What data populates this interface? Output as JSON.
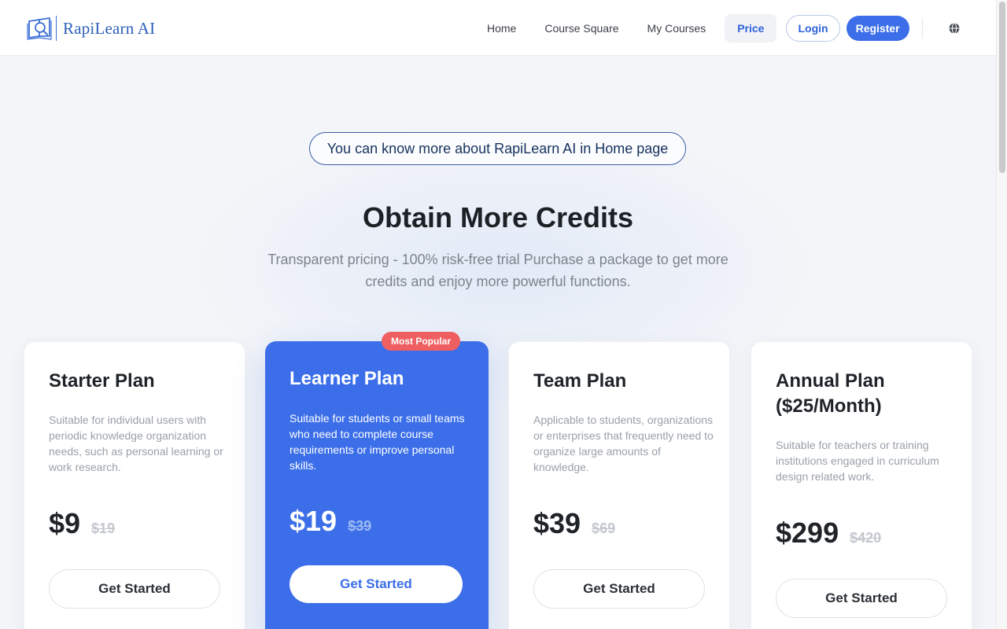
{
  "header": {
    "logo_text": "RapiLearn AI",
    "nav": [
      {
        "label": "Home"
      },
      {
        "label": "Course Square"
      },
      {
        "label": "My Courses"
      },
      {
        "label": "Price",
        "active": true
      }
    ],
    "login_label": "Login",
    "register_label": "Register",
    "language_icon": "globe-icon"
  },
  "hero": {
    "home_link": "You can know more about RapiLearn AI in Home page",
    "title": "Obtain More Credits",
    "subtitle": "Transparent pricing - 100% risk-free trial Purchase a package to get more credits and enjoy more powerful functions."
  },
  "plans": [
    {
      "name": "Starter Plan",
      "description": "Suitable for individual users with periodic knowledge organization needs, such as personal learning or work research.",
      "price": "$9",
      "old_price": "$19",
      "cta": "Get Started"
    },
    {
      "name": "Learner Plan",
      "badge": "Most Popular",
      "description": "Suitable for students or small teams who need to complete course requirements or improve personal skills.",
      "price": "$19",
      "old_price": "$39",
      "cta": "Get Started"
    },
    {
      "name": "Team Plan",
      "description": "Applicable to students, organizations or enterprises that frequently need to organize large amounts of knowledge.",
      "price": "$39",
      "old_price": "$69",
      "cta": "Get Started"
    },
    {
      "name": "Annual Plan ($25/Month)",
      "description": "Suitable for teachers or training institutions engaged in curriculum design related work.",
      "price": "$299",
      "old_price": "$420",
      "cta": "Get Started"
    }
  ],
  "colors": {
    "accent": "#3b6ee8",
    "badge": "#ef5f61",
    "background": "#f3f5f8"
  }
}
